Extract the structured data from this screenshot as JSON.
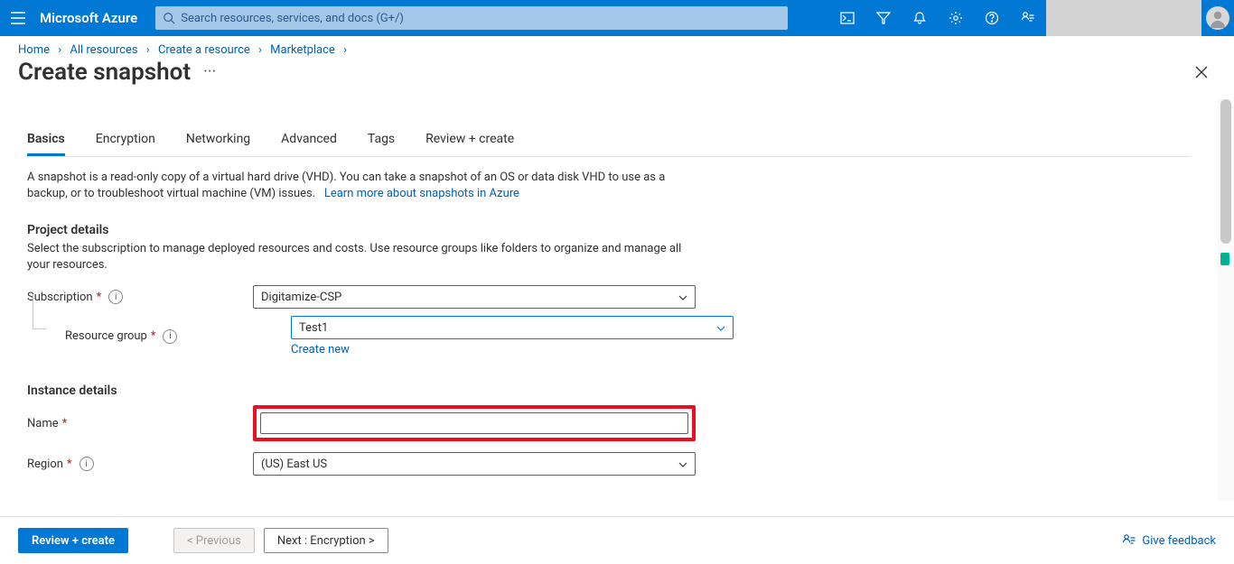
{
  "brand": "Microsoft Azure",
  "search": {
    "placeholder": "Search resources, services, and docs (G+/)"
  },
  "breadcrumbs": [
    {
      "label": "Home"
    },
    {
      "label": "All resources"
    },
    {
      "label": "Create a resource"
    },
    {
      "label": "Marketplace"
    }
  ],
  "page": {
    "title": "Create snapshot"
  },
  "tabs": [
    {
      "label": "Basics",
      "active": true
    },
    {
      "label": "Encryption"
    },
    {
      "label": "Networking"
    },
    {
      "label": "Advanced"
    },
    {
      "label": "Tags"
    },
    {
      "label": "Review + create"
    }
  ],
  "description": {
    "text": "A snapshot is a read-only copy of a virtual hard drive (VHD). You can take a snapshot of an OS or data disk VHD to use as a backup, or to troubleshoot virtual machine (VM) issues.",
    "link": "Learn more about snapshots in Azure"
  },
  "sections": {
    "project": {
      "title": "Project details",
      "sub": "Select the subscription to manage deployed resources and costs. Use resource groups like folders to organize and manage all your resources."
    },
    "instance": {
      "title": "Instance details"
    }
  },
  "fields": {
    "subscription": {
      "label": "Subscription",
      "value": "Digitamize-CSP"
    },
    "resource_group": {
      "label": "Resource group",
      "value": "Test1",
      "create_new": "Create new"
    },
    "name": {
      "label": "Name",
      "value": ""
    },
    "region": {
      "label": "Region",
      "value": "(US) East US"
    }
  },
  "footer": {
    "review": "Review + create",
    "previous": "< Previous",
    "next": "Next : Encryption >",
    "feedback": "Give feedback"
  }
}
